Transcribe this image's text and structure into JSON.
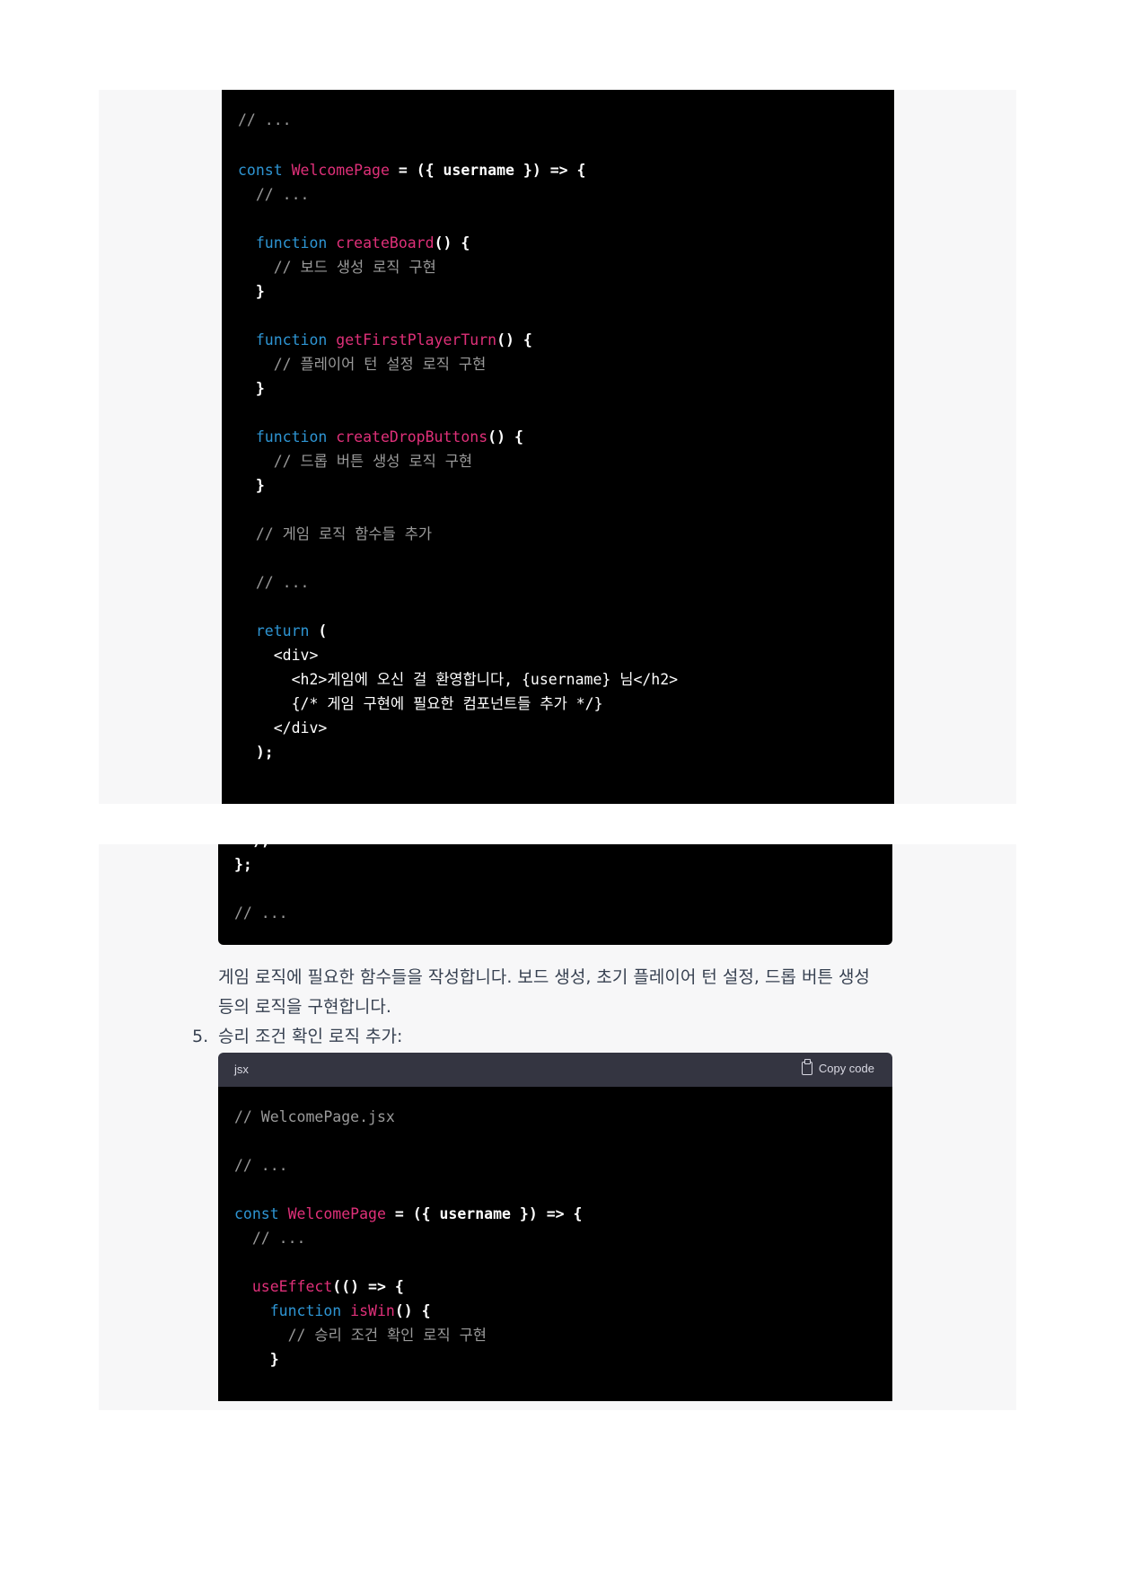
{
  "block1_lines": [
    "// ...",
    "",
    "const WelcomePage = ({ username }) => {",
    "  // ...",
    "",
    "  function createBoard() {",
    "    // 보드 생성 로직 구현",
    "  }",
    "",
    "  function getFirstPlayerTurn() {",
    "    // 플레이어 턴 설정 로직 구현",
    "  }",
    "",
    "  function createDropButtons() {",
    "    // 드롭 버튼 생성 로직 구현",
    "  }",
    "",
    "  // 게임 로직 함수들 추가",
    "",
    "  // ...",
    "",
    "  return (",
    "    <div>",
    "      <h2>게임에 오신 걸 환영합니다, {username} 님</h2>",
    "      {/* 게임 구현에 필요한 컴포넌트들 추가 */}",
    "    </div>",
    "  );"
  ],
  "block2_lines": [
    "  );",
    "};",
    "",
    "// ..."
  ],
  "prose": {
    "paragraph_line1": "게임 로직에 필요한 함수들을 작성합니다. 보드 생성, 초기 플레이어 턴 설정, 드롭 버튼 생성",
    "paragraph_line2": "등의 로직을 구현합니다.",
    "step_number": "5.",
    "step_text": "승리 조건 확인 로직 추가:"
  },
  "code_header": {
    "language": "jsx",
    "copy_label": "Copy code",
    "copy_icon": "clipboard-icon"
  },
  "block3_lines": [
    "// WelcomePage.jsx",
    "",
    "// ...",
    "",
    "const WelcomePage = ({ username }) => {",
    "  // ...",
    "",
    "  useEffect(() => {",
    "    function isWin() {",
    "      // 승리 조건 확인 로직 구현",
    "    }"
  ],
  "colors": {
    "page_bg": "#ffffff",
    "panel_bg": "#f7f7f8",
    "code_bg": "#000000",
    "code_header_bg": "#343541",
    "keyword": "#2e95d3",
    "function_name": "#df3079",
    "comment": "#9a9a9a",
    "prose_text": "#374151"
  }
}
